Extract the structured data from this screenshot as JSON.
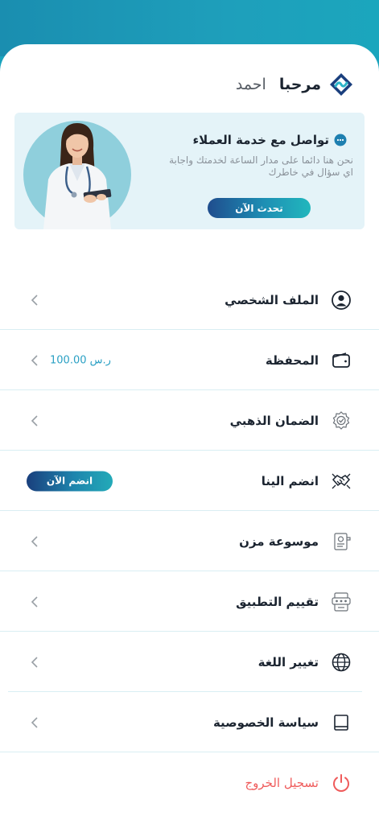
{
  "greeting": {
    "welcome": "مرحبا",
    "name": "احمد"
  },
  "support_card": {
    "title": "تواصل مع خدمة العملاء",
    "description": "نحن هنا دائما على مدار الساعة لخدمتك واجابة اي سؤال في خاطرك",
    "button_label": "تحدث الآن"
  },
  "menu": [
    {
      "label": "الملف الشخصي",
      "icon": "user-circle-icon"
    },
    {
      "label": "المحفظة",
      "icon": "wallet-icon",
      "value": "100.00 ر.س"
    },
    {
      "label": "الضمان الذهبي",
      "icon": "award-badge-icon"
    },
    {
      "label": "انضم الينا",
      "icon": "handshake-icon",
      "badge": "انضم الآن"
    },
    {
      "label": "موسوعة مزن",
      "icon": "encyclopedia-icon"
    },
    {
      "label": "تقييم التطبيق",
      "icon": "rating-icon"
    },
    {
      "label": "تغيير اللغة",
      "icon": "globe-icon"
    },
    {
      "label": "سياسة الخصوصية",
      "icon": "book-icon"
    },
    {
      "label": "تسجيل الخروج",
      "icon": "power-icon"
    }
  ],
  "colors": {
    "accent": "#1aa3bd",
    "logout": "#ef5b5b",
    "value_text": "#2aa0c4"
  }
}
